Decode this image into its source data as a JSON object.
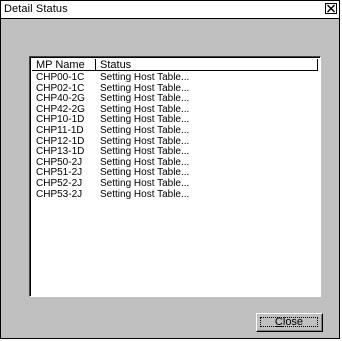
{
  "window": {
    "title": "Detail Status"
  },
  "list": {
    "columns": [
      "MP Name",
      "Status"
    ],
    "rows": [
      {
        "name": "CHP00-1C",
        "status": "Setting Host Table..."
      },
      {
        "name": "CHP02-1C",
        "status": "Setting Host Table..."
      },
      {
        "name": "CHP40-2G",
        "status": "Setting Host Table..."
      },
      {
        "name": "CHP42-2G",
        "status": "Setting Host Table..."
      },
      {
        "name": "CHP10-1D",
        "status": "Setting Host Table..."
      },
      {
        "name": "CHP11-1D",
        "status": "Setting Host Table..."
      },
      {
        "name": "CHP12-1D",
        "status": "Setting Host Table..."
      },
      {
        "name": "CHP13-1D",
        "status": "Setting Host Table..."
      },
      {
        "name": "CHP50-2J",
        "status": "Setting Host Table..."
      },
      {
        "name": "CHP51-2J",
        "status": "Setting Host Table..."
      },
      {
        "name": "CHP52-2J",
        "status": "Setting Host Table..."
      },
      {
        "name": "CHP53-2J",
        "status": "Setting Host Table..."
      }
    ]
  },
  "buttons": {
    "close_mnemonic": "C",
    "close_rest": "lose"
  },
  "icons": {
    "title_close": "close-icon"
  }
}
